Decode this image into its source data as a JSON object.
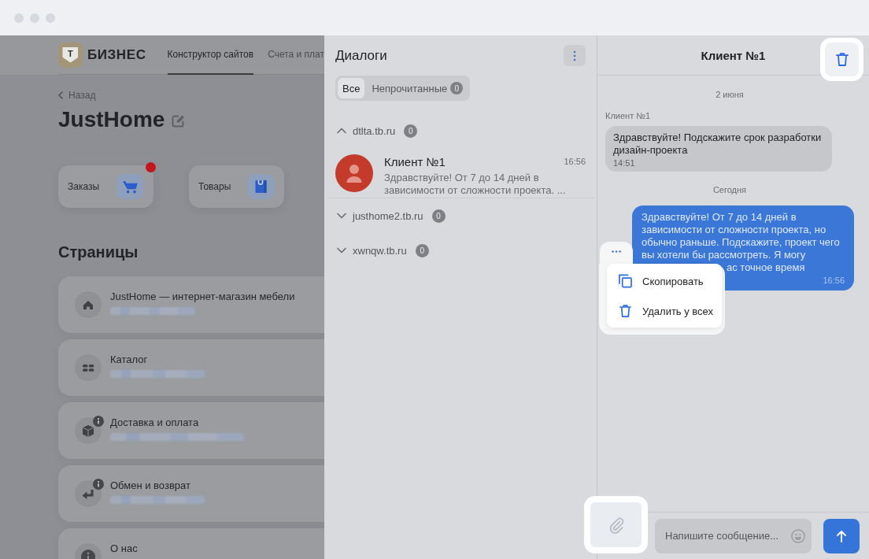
{
  "site": {
    "logo": {
      "mark": "Т",
      "name": "БИЗНЕС"
    },
    "nav": [
      {
        "label": "Конструктор сайтов",
        "selected": true
      },
      {
        "label": "Счета и плат",
        "selected": false
      }
    ],
    "back_link": "Назад",
    "title": "JustHome",
    "shortcuts": [
      {
        "label": "Заказы",
        "notification": true
      },
      {
        "label": "Товары",
        "notification": false
      }
    ],
    "pages_heading": "Страницы",
    "pages": [
      {
        "title": "JustHome — интернет-магазин мебели",
        "notice": false
      },
      {
        "title": "Каталог",
        "notice": false
      },
      {
        "title": "Доставка и оплата",
        "notice": true
      },
      {
        "title": "Обмен и возврат",
        "notice": true
      },
      {
        "title": "О нас",
        "notice": false
      }
    ]
  },
  "dialogs": {
    "title": "Диалоги",
    "filters": [
      {
        "label": "Все",
        "selected": true
      },
      {
        "label": "Непрочитанные",
        "selected": false,
        "count": "0"
      }
    ],
    "groups": [
      {
        "domain": "dtlta.tb.ru",
        "count": "0",
        "expanded": true,
        "chats": [
          {
            "name": "Клиент №1",
            "time": "16:56",
            "preview": [
              "Здравствуйте! От 7 до 14 дней в",
              "зависимости от сложности проекта. ..."
            ]
          }
        ]
      },
      {
        "domain": "justhome2.tb.ru",
        "count": "0",
        "expanded": false
      },
      {
        "domain": "xwnqw.tb.ru",
        "count": "0",
        "expanded": false
      }
    ]
  },
  "chat": {
    "title": "Клиент №1",
    "delete_button": {
      "highlighted": true
    },
    "messages": [
      {
        "kind": "date",
        "text": "2 июня"
      },
      {
        "kind": "incoming",
        "sender": "Клиент №1",
        "lines": [
          "Здравствуйте! Подскажите срок разработки",
          "дизайн-проекта"
        ],
        "time": "14:51"
      },
      {
        "kind": "date",
        "text": "Сегодня"
      },
      {
        "kind": "outgoing",
        "lines": [
          "Здравствуйте! От 7 до 14 дней в",
          "зависимости от сложности проекта, но",
          "обычно раньше. Подскажите, проект чего",
          "вы хотели бы рассмотреть. Я могу"
        ],
        "tail": "ас точное время",
        "time": "16:56"
      }
    ],
    "context_menu": {
      "items": [
        {
          "label": "Скопировать"
        },
        {
          "label": "Удалить у всех"
        }
      ]
    },
    "composer": {
      "placeholder": "Напишите сообщение...",
      "attach_highlighted": true
    }
  }
}
